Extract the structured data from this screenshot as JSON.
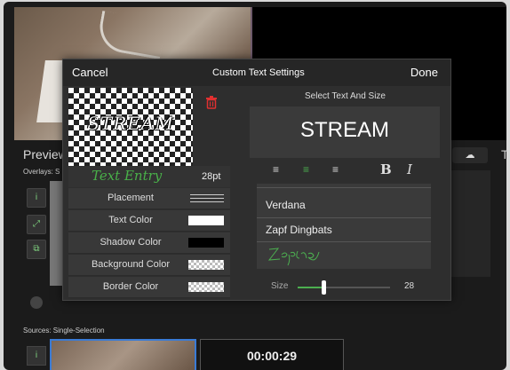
{
  "background": {
    "preview_label": "Preview",
    "overlays_label": "Overlays:  S",
    "sources_label": "Sources:  Single-Selection",
    "timer": "00:00:29",
    "right_label": "T"
  },
  "dialog": {
    "cancel": "Cancel",
    "title": "Custom Text Settings",
    "done": "Done",
    "preview_text": "STREAM",
    "text_entry": "Text Entry",
    "font_size_pt": "28pt",
    "rows": [
      {
        "label": "Placement"
      },
      {
        "label": "Text Color",
        "color": "#ffffff"
      },
      {
        "label": "Shadow Color",
        "color": "#000000"
      },
      {
        "label": "Background Color",
        "color": "checker"
      },
      {
        "label": "Border Color",
        "color": "checker"
      }
    ],
    "select_header": "Select Text And Size",
    "sample_text": "STREAM",
    "bold": "B",
    "italic": "I",
    "fonts": [
      "Verdana",
      "Zapf Dingbats",
      "Zapfino"
    ],
    "size_label": "Size",
    "size_value": "28",
    "size_fraction": 0.28
  },
  "colors": {
    "accent_green": "#4caf50",
    "delete_red": "#e03030"
  }
}
